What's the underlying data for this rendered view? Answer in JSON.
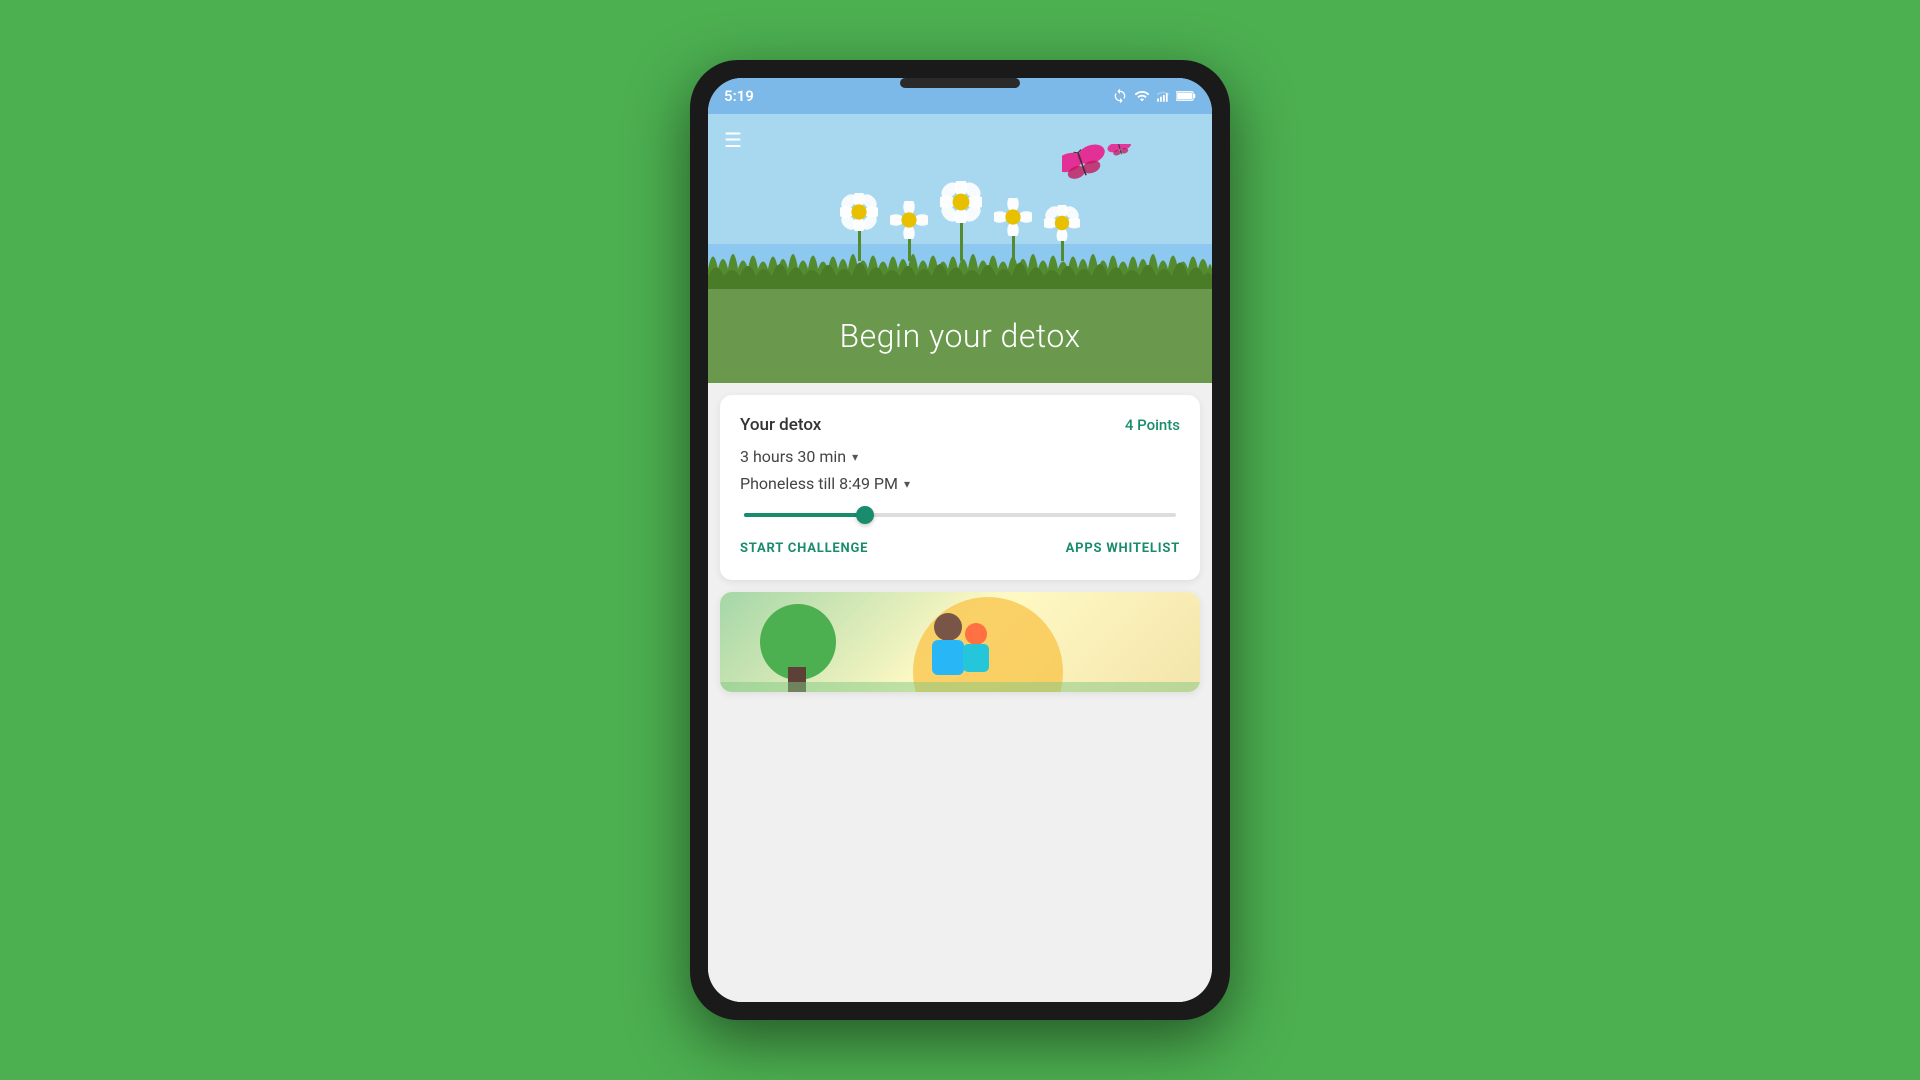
{
  "status_bar": {
    "time": "5:19",
    "icons": [
      "sync-icon",
      "wifi-icon",
      "signal-icon",
      "battery-icon"
    ]
  },
  "header": {
    "menu_label": "☰",
    "title": "Begin your detox"
  },
  "detox_card": {
    "title": "Your detox",
    "points": "4 Points",
    "duration": "3 hours 30 min",
    "phoneless_label": "Phoneless till 8:49 PM",
    "slider_value": 28,
    "start_challenge_label": "START CHALLENGE",
    "apps_whitelist_label": "APPS WHITELIST"
  },
  "colors": {
    "sky": "#a8d8f0",
    "grass": "#558b2f",
    "title_bg": "#6a994e",
    "teal": "#1a8c6e",
    "card_bg": "#ffffff",
    "background": "#4caf50"
  }
}
